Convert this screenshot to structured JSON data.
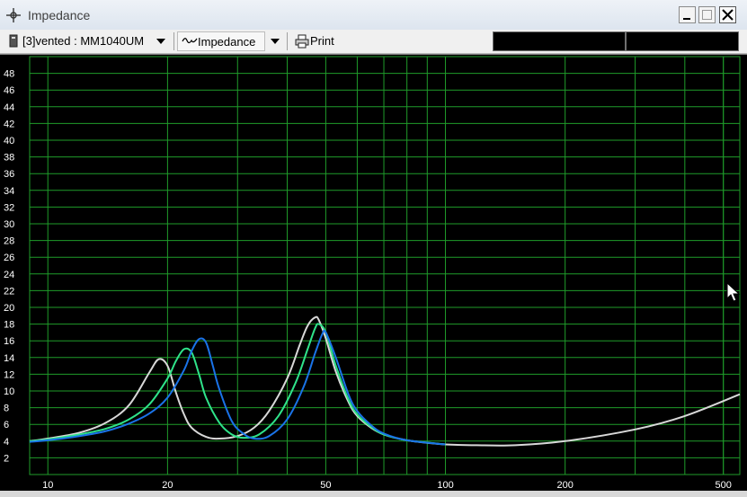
{
  "window": {
    "title": "Impedance",
    "icon": "crosshair-icon",
    "controls": [
      "minimize-icon",
      "maximize-icon",
      "close-icon"
    ]
  },
  "toolbar": {
    "project_label": "[3]vented : MM1040UM",
    "view_label": "Impedance",
    "print_label": "Print",
    "readout_1": "",
    "readout_2": ""
  },
  "colors": {
    "background": "#000000",
    "grid": "#1f9c2a",
    "axis_text": "#ffffff",
    "series": [
      "#d8d8d8",
      "#2fe38a",
      "#1a73e8"
    ]
  },
  "chart_data": {
    "type": "line",
    "title": "",
    "xlabel": "",
    "ylabel": "",
    "x_scale": "log",
    "xlim": [
      9,
      550
    ],
    "ylim": [
      0,
      50
    ],
    "grid": true,
    "x_tick_labels": [
      "10",
      "20",
      "50",
      "100",
      "200",
      "500"
    ],
    "y_tick_labels": [
      "2",
      "4",
      "6",
      "8",
      "10",
      "12",
      "14",
      "16",
      "18",
      "20",
      "22",
      "24",
      "26",
      "28",
      "30",
      "32",
      "34",
      "36",
      "38",
      "40",
      "42",
      "44",
      "46",
      "48"
    ],
    "series": [
      {
        "color": "#d8d8d8",
        "x": [
          9,
          10,
          12,
          14,
          16,
          18,
          19,
          20,
          21,
          22,
          23,
          25,
          27,
          30,
          33,
          36,
          40,
          43,
          45,
          47,
          48,
          50,
          53,
          57,
          60,
          65,
          70,
          80,
          90,
          100,
          120,
          150,
          200,
          300,
          400,
          550
        ],
        "y": [
          4.0,
          4.3,
          5.0,
          6.2,
          8.3,
          12.2,
          13.8,
          13.0,
          9.8,
          7.2,
          5.6,
          4.5,
          4.3,
          4.6,
          5.6,
          7.6,
          11.5,
          15.5,
          17.8,
          18.8,
          18.5,
          16.3,
          12.3,
          8.7,
          7.0,
          5.6,
          4.8,
          4.1,
          3.8,
          3.6,
          3.5,
          3.5,
          4.0,
          5.4,
          7.0,
          9.6
        ]
      },
      {
        "color": "#2fe38a",
        "x": [
          9,
          10,
          12,
          14,
          16,
          18,
          20,
          21,
          22,
          23,
          24,
          25,
          27,
          29,
          31,
          34,
          38,
          42,
          45,
          47,
          48,
          50,
          53,
          57,
          60,
          65,
          70,
          80,
          100
        ],
        "y": [
          4.0,
          4.2,
          4.8,
          5.5,
          6.6,
          8.4,
          11.5,
          13.6,
          15.0,
          14.6,
          12.0,
          9.2,
          6.2,
          4.8,
          4.4,
          4.8,
          7.0,
          11.0,
          15.0,
          17.5,
          18.0,
          17.0,
          13.0,
          9.0,
          7.2,
          5.7,
          4.8,
          4.1,
          3.6
        ]
      },
      {
        "color": "#1a73e8",
        "x": [
          9,
          10,
          12,
          14,
          16,
          18,
          20,
          22,
          23,
          24,
          25,
          26,
          27,
          29,
          31,
          33,
          36,
          40,
          44,
          47,
          49,
          50,
          53,
          57,
          60,
          65,
          70,
          80,
          100
        ],
        "y": [
          3.9,
          4.1,
          4.6,
          5.2,
          6.1,
          7.3,
          9.2,
          12.5,
          14.8,
          16.2,
          15.8,
          13.0,
          10.2,
          6.4,
          4.9,
          4.3,
          4.6,
          6.6,
          10.5,
          14.5,
          16.8,
          17.0,
          14.0,
          9.6,
          7.6,
          5.9,
          4.9,
          4.1,
          3.6
        ]
      }
    ]
  }
}
